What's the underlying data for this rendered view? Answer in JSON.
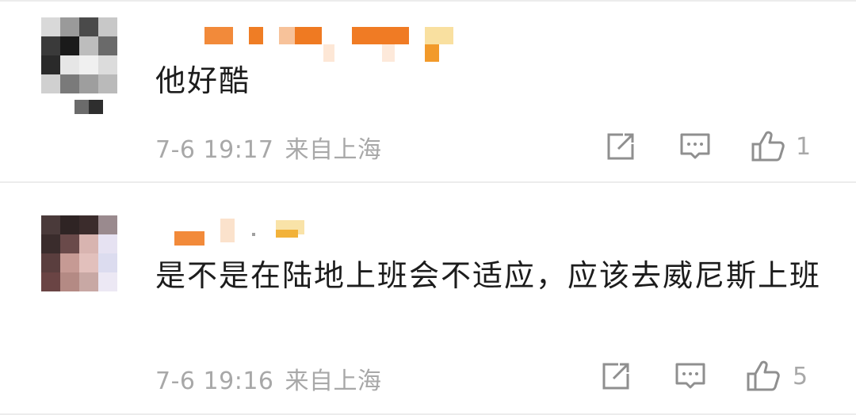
{
  "comments": [
    {
      "text": "他好酷",
      "time": "7-6 19:17",
      "location": "来自上海",
      "likes": "1"
    },
    {
      "text": "是不是在陆地上班会不适应，应该去威尼斯上班",
      "time": "7-6 19:16",
      "location": "来自上海",
      "likes": "5"
    }
  ],
  "icons": {
    "share": "share-icon",
    "comment": "comment-icon",
    "like": "like-icon"
  },
  "colors": {
    "text": "#1c1c1c",
    "meta": "#a8a8a8",
    "name_blur": "#f08a30"
  }
}
